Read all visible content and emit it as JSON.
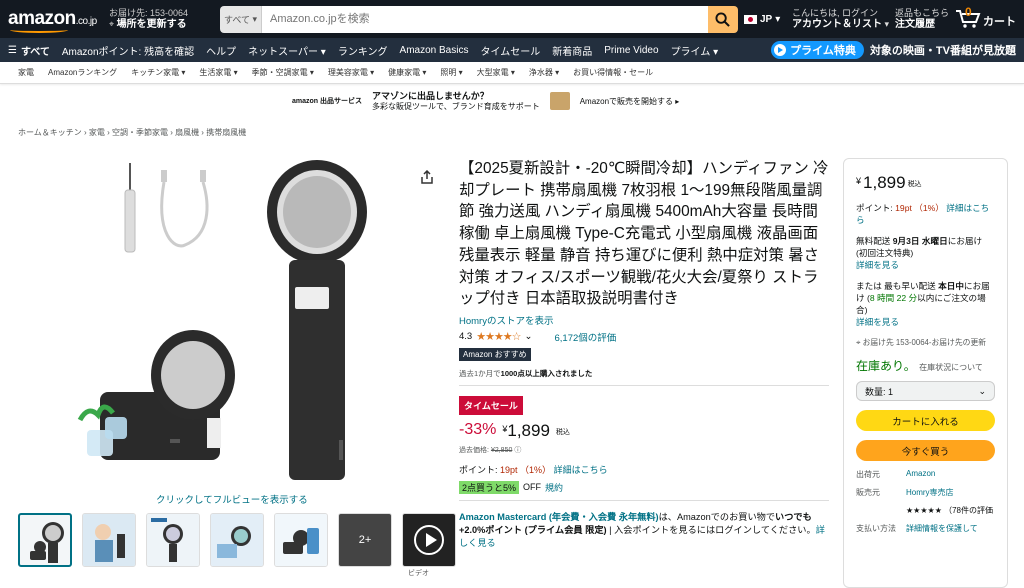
{
  "header": {
    "logo": "amazon",
    "logo_suffix": ".co.jp",
    "deliver_line1": "お届け先: 153-0064",
    "deliver_line2": "場所を更新する",
    "search_category": "すべて",
    "search_placeholder": "Amazon.co.jpを検索",
    "lang": "JP",
    "account_line1": "こんにちは, ログイン",
    "account_line2": "アカウント＆リスト",
    "orders_line1": "返品もこちら",
    "orders_line2": "注文履歴",
    "cart_count": "0",
    "cart_label": "カート"
  },
  "nav": {
    "all": "すべて",
    "items": [
      "Amazonポイント: 残高を確認",
      "ヘルプ",
      "ネットスーパー ▾",
      "ランキング",
      "Amazon Basics",
      "タイムセール",
      "新着商品",
      "Prime Video",
      "プライム ▾"
    ],
    "prime_badge": "プライム特典",
    "prime_text": "対象の映画・TV番組が見放題"
  },
  "subnav": [
    "家電",
    "Amazonランキング",
    "キッチン家電 ▾",
    "生活家電 ▾",
    "季節・空調家電 ▾",
    "理美容家電 ▾",
    "健康家電 ▾",
    "照明 ▾",
    "大型家電 ▾",
    "浄水器 ▾",
    "お買い得情報・セール"
  ],
  "banner": {
    "brand": "amazon 出品サービス",
    "title": "アマゾンに出品しませんか？",
    "sub": "多彩な販促ツールで、ブランド育成をサポート",
    "cta": "Amazonで販売を開始する ▸"
  },
  "breadcrumb": "ホーム＆キッチン › 家電 › 空調・季節家電 › 扇風機 › 携帯扇風機",
  "gallery": {
    "fullview": "クリックしてフルビューを表示する",
    "more": "2+",
    "video_label": "ビデオ"
  },
  "product": {
    "title": "【2025夏新設計・-20℃瞬間冷却】ハンディファン 冷却プレート 携帯扇風機 7枚羽根 1～199無段階風量調節 強力送風 ハンディ扇風機 5400mAh大容量 長時間稼働 卓上扇風機 Type-C充電式 小型扇風機 液晶画面 残量表示 軽量 静音 持ち運びに便利 熱中症対策 暑さ対策 オフィス/スポーツ観戦/花火大会/夏祭り ストラップ付き 日本語取扱説明書付き",
    "store": "Homryのストアを表示",
    "rating": "4.3",
    "stars": "★★★★☆",
    "reviews": "6,172個の評価",
    "badge": "Amazon おすすめ",
    "bought_pre": "過去1か月で",
    "bought_bold": "1000点以上購入されました",
    "sale": "タイムセール",
    "discount": "-33%",
    "currency": "¥",
    "price": "1,899",
    "tax": "税込",
    "ref_label": "過去価格:",
    "ref_price": "¥2,850",
    "points_label": "ポイント:",
    "points_value": "19pt （1%）",
    "points_link": "詳細はこちら",
    "off_badge": "2点買うと5%",
    "off_text": "OFF",
    "off_link": "規約",
    "mc_bold": "Amazon Mastercard (年会費・入会費 永年無料)",
    "mc_text1": "は、Amazonでのお買い物で",
    "mc_blue": "いつでも+2.0%ポイント (プライム会員 限定)",
    "mc_text2": " | 入会ポイントを見るにはログインしてください。",
    "mc_link": "詳しく見る"
  },
  "buybox": {
    "currency": "¥",
    "price": "1,899",
    "tax": "税込",
    "points_label": "ポイント:",
    "points_value": "19pt （1%）",
    "points_link": "詳細はこちら",
    "free_ship": "無料配送",
    "date": "9月3日 水曜日",
    "date_suffix": "にお届け (初回注文特典)",
    "details1": "詳細を見る",
    "fast_pre": "または 最も早い配送",
    "fast_date": "本日中",
    "fast_mid": "にお届け (",
    "fast_time": "8 時間 22 分",
    "fast_suf": "以内にご注文の場合)",
    "details2": "詳細を見る",
    "location": "お届け先 153-0064-お届け先の更新",
    "instock": "在庫あり。",
    "stock_status": "在庫状況について",
    "qty": "数量: 1",
    "add_cart": "カートに入れる",
    "buy_now": "今すぐ買う",
    "info": [
      {
        "k": "出荷元",
        "v": "Amazon"
      },
      {
        "k": "販売元",
        "v": "Homry専売店"
      },
      {
        "k": "",
        "v": "★★★★★ （78件の評価"
      },
      {
        "k": "支払い方法",
        "v": "詳細情報を保護して"
      }
    ]
  }
}
